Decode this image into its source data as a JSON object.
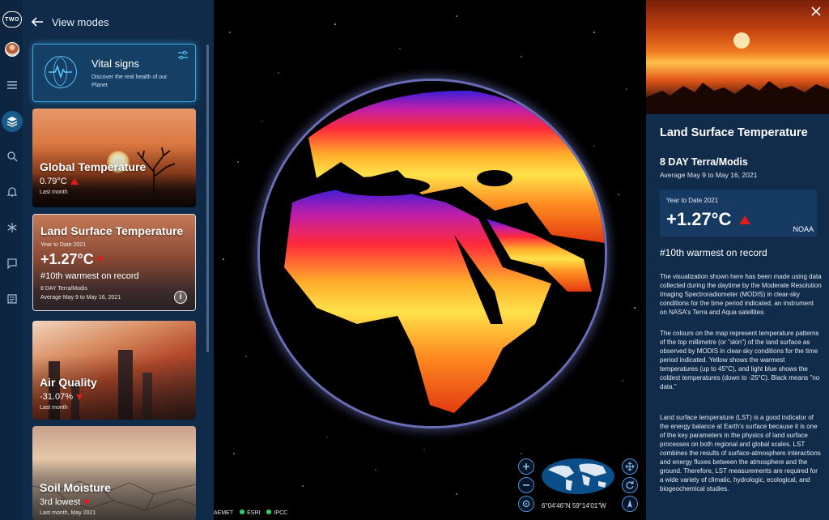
{
  "rail": {
    "logo": "TWO",
    "icons": [
      "avatar",
      "menu-icon",
      "layers-icon",
      "search-icon",
      "bell-icon",
      "snowflake-icon",
      "chat-icon",
      "news-icon"
    ]
  },
  "panel": {
    "header": {
      "back_icon": "arrow-left-icon",
      "title": "View modes"
    },
    "vital": {
      "title": "Vital signs",
      "desc": "Discover the real health of our Planet",
      "icon": "globe-pulse-icon",
      "settings_icon": "sliders-icon"
    },
    "cards": [
      {
        "title": "Global Temperature",
        "value": "0.79°C",
        "trend": "up",
        "sub": "Last month"
      },
      {
        "title": "Land Surface Temperature",
        "pre": "Year to Date 2021",
        "value": "+1.27°C",
        "trend": "down",
        "rank": "#10th warmest on record",
        "source": "8 DAY Terra/Modis",
        "period": "Average May 9 to May 16, 2021",
        "info_icon": "info-icon"
      },
      {
        "title": "Air Quality",
        "value": "-31.07%",
        "trend": "down",
        "sub": "Last month"
      },
      {
        "title": "Soil Moisture",
        "value": "3rd lowest",
        "trend": "down",
        "sub": "Last month, May 2021"
      }
    ]
  },
  "globe": {
    "coords": "6°04'46\"N 59°14'01\"W",
    "credits": [
      "AEMET",
      "ESRI",
      "IPCC"
    ],
    "controls": [
      "zoom-in-icon",
      "zoom-out-icon",
      "locate-icon",
      "pan-icon",
      "rotate-icon",
      "north-icon"
    ]
  },
  "detail": {
    "close_icon": "close-icon",
    "title": "Land Surface Temperature",
    "subtitle": "8 DAY Terra/Modis",
    "period": "Average May 9 to May 16, 2021",
    "ytd_label": "Year to Date 2021",
    "ytd_value": "+1.27°C",
    "ytd_source": "NOAA",
    "rank": "#10th warmest on record",
    "p1": "The visualization shown here has been made using data collected during the daytime by the Moderate Resolution Imaging Spectroradiometer (MODIS) in clear-sky conditions for the time period indicated, an instrument on NASA's Terra and Aqua satellites.",
    "p2": "The colours on the map represent temperature patterns of the top millimetre (or \"skin\") of the land surface as observed by MODIS in clear-sky conditions for the time period indicated. Yellow shows the warmest temperatures (up to 45°C), and light blue shows the coldest temperatures (down to -25°C). Black means \"no data.\"",
    "p3": "Land surface temperature (LST) is a good indicator of the energy balance at Earth's surface because it is one of the key parameters in the physics of land surface processes on both regional and global scales. LST combines the results of surface-atmosphere interactions and energy fluxes between the atmosphere and the ground. Therefore, LST measurements are required for a wide variety of climatic, hydrologic, ecological, and biogeochemical studies."
  },
  "colors": {
    "panel": "#102b4a",
    "accent": "#38a6e0",
    "alert": "#e31a1a",
    "credit_dot": "#2bd36a"
  }
}
